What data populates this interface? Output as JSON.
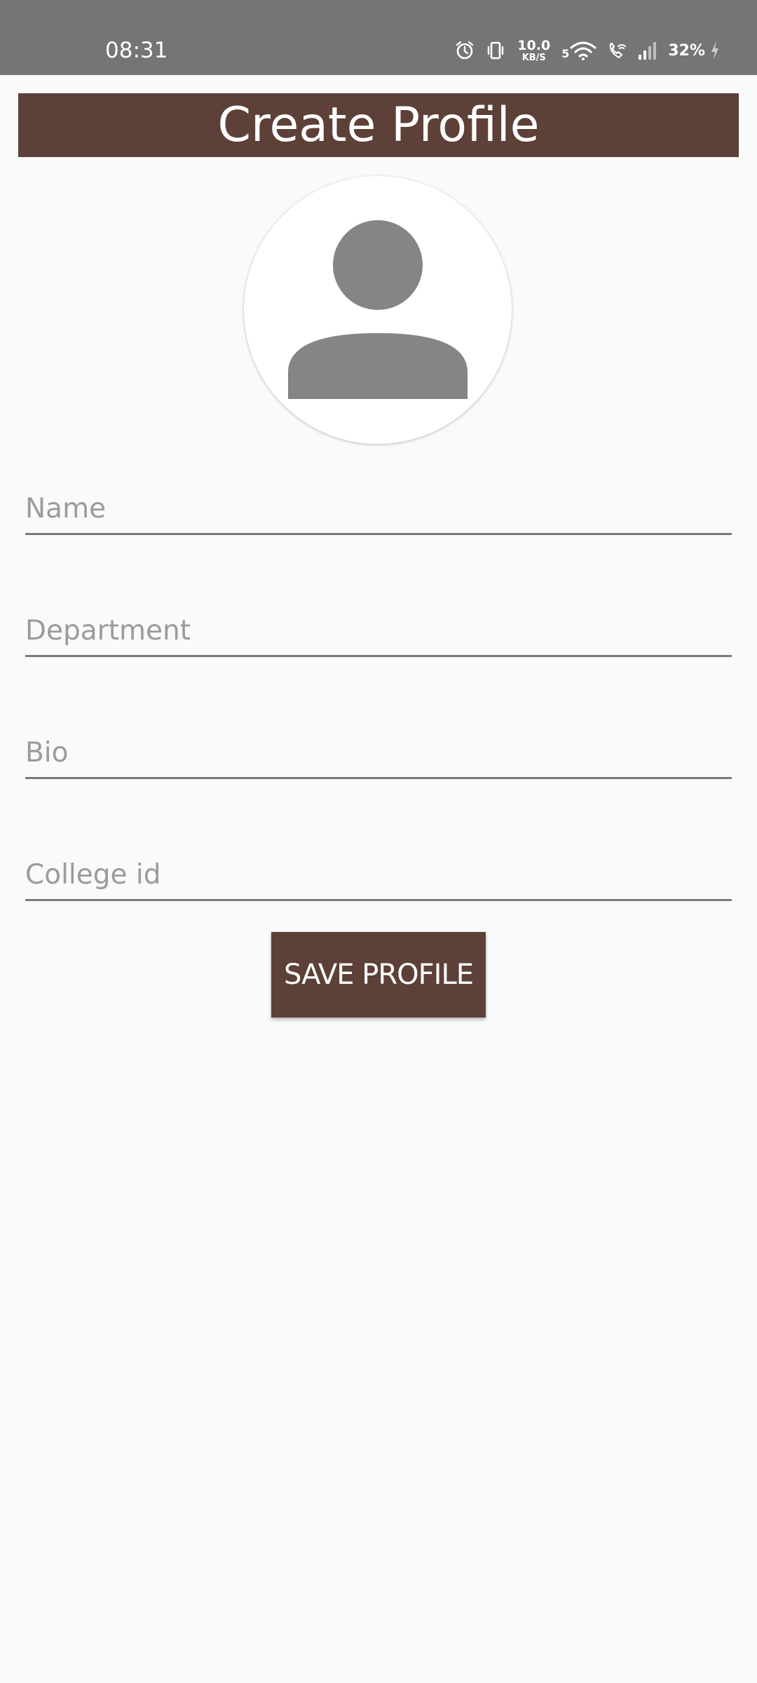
{
  "status_bar": {
    "time": "08:31",
    "net_speed_value": "10.0",
    "net_speed_unit": "KB/S",
    "wifi_label": "5",
    "battery": "32%",
    "icons": [
      "alarm-icon",
      "vibrate-icon",
      "wifi-icon",
      "wifi-call-icon",
      "signal-icon",
      "charging-icon"
    ],
    "background": "#757575"
  },
  "header": {
    "title": "Create Profile",
    "background": "#5d4037"
  },
  "avatar": {
    "icon": "person-icon",
    "color": "#858585"
  },
  "form": {
    "name_placeholder": "Name",
    "department_placeholder": "Department",
    "bio_placeholder": "Bio",
    "college_id_placeholder": "College id"
  },
  "actions": {
    "save_label": "SAVE PROFILE",
    "accent": "#5d4037"
  }
}
